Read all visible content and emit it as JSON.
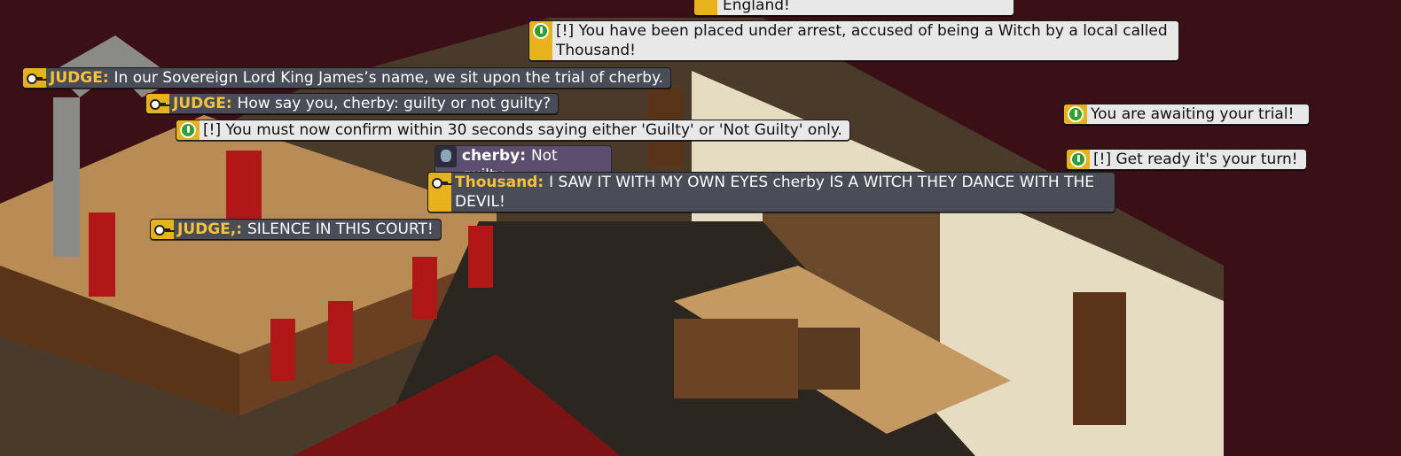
{
  "chat": [
    {
      "speaker": "",
      "text": "England!"
    },
    {
      "speaker": "",
      "text": "[!] You have been placed under arrest, accused of being a Witch by a local called Thousand!"
    },
    {
      "speaker": "JUDGE",
      "text": "In our Sovereign Lord King James’s name, we sit upon the trial of cherby."
    },
    {
      "speaker": "JUDGE",
      "text": "How say you, cherby: guilty or not guilty?"
    },
    {
      "speaker": "",
      "text": "[!] You must now confirm within 30 seconds saying either  'Guilty' or 'Not Guilty' only."
    },
    {
      "speaker": "cherby",
      "text": "Not guilty"
    },
    {
      "speaker": "Thousand",
      "text": "I SAW IT WITH MY OWN EYES cherby IS A WITCH THEY DANCE WITH THE DEVIL!"
    },
    {
      "speaker": "JUDGE,",
      "text": "SILENCE IN THIS COURT!"
    },
    {
      "speaker": "",
      "text": "You are awaiting your trial!"
    },
    {
      "speaker": "",
      "text": "[!] Get ready it's your turn!"
    }
  ],
  "icons": {
    "system": "green-alert-icon",
    "staff": "key-icon",
    "user": "avatar-head-icon"
  },
  "colors": {
    "sky": "#3a0f16",
    "floor": "#c9a06a",
    "wall": "#e8e0c8",
    "wood": "#6b3f22",
    "banner": "#b01818",
    "bubble_dark": "#4a4d57",
    "bubble_light": "#e8e8e8",
    "name_gold": "#f2c33a",
    "badge_green": "#2f9f2f"
  }
}
